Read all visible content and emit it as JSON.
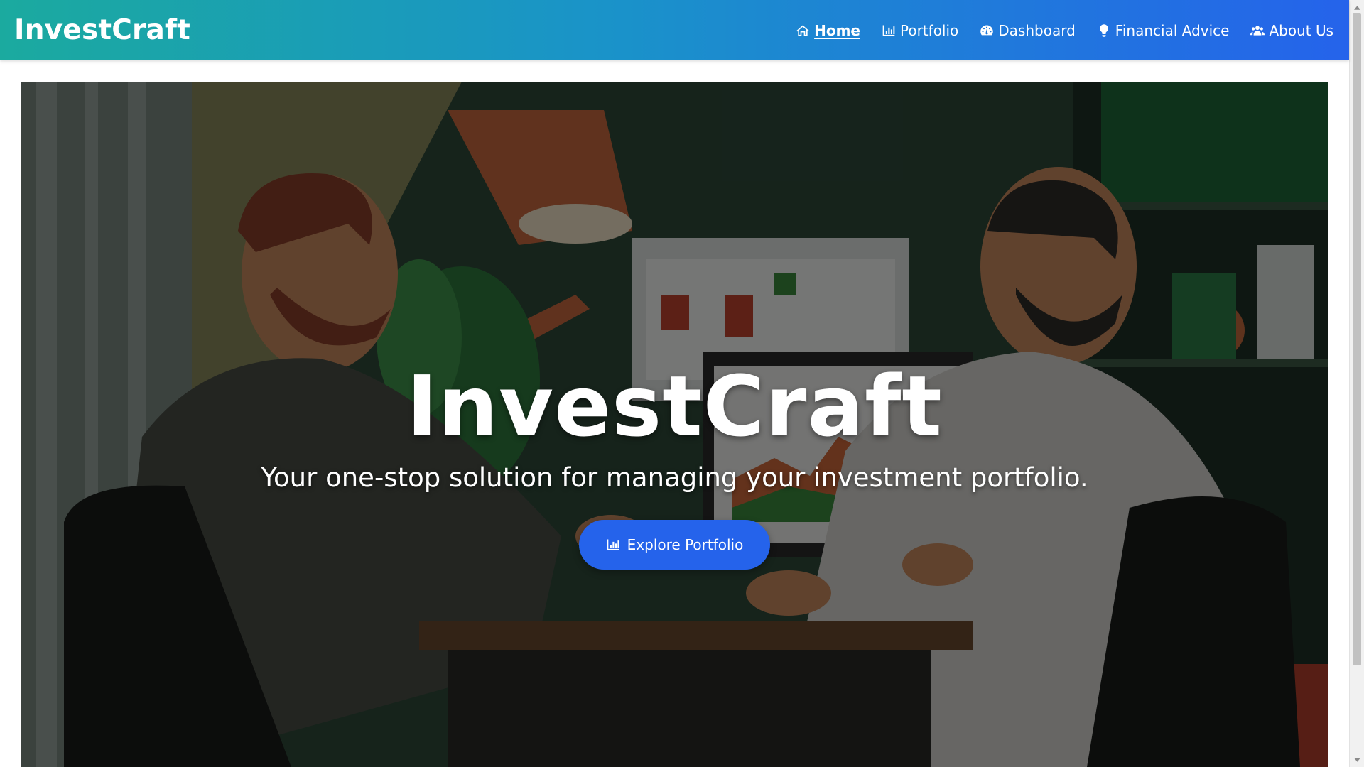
{
  "brand": "InvestCraft",
  "nav": {
    "items": [
      {
        "label": "Home",
        "icon": "home-icon",
        "active": true
      },
      {
        "label": "Portfolio",
        "icon": "chart-bar-icon",
        "active": false
      },
      {
        "label": "Dashboard",
        "icon": "gauge-icon",
        "active": false
      },
      {
        "label": "Financial Advice",
        "icon": "lightbulb-icon",
        "active": false
      },
      {
        "label": "About Us",
        "icon": "users-icon",
        "active": false
      }
    ]
  },
  "hero": {
    "title": "InvestCraft",
    "subtitle": "Your one-stop solution for managing your investment portfolio.",
    "cta_label": "Explore Portfolio",
    "cta_icon": "chart-bar-icon",
    "image_description_icon": "office-meeting-illustration"
  },
  "colors": {
    "nav_gradient_start": "#1baa9f",
    "nav_gradient_end": "#2563eb",
    "accent": "#2563eb",
    "text_on_dark": "#ffffff"
  }
}
